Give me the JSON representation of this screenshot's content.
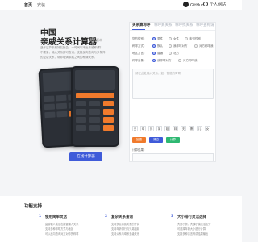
{
  "topbar": {
    "brand": "首页",
    "nav_link": "安装",
    "github": "GitHub",
    "personal": "个人网站"
  },
  "hero": {
    "title_line1": "中国",
    "title_line2": "亲戚关系计算器",
    "version": "最新版本",
    "desc_line1": "逢年过节亲朋好友聚会，一时间叫不出亲戚称谓？",
    "desc_line2": "不要紧，输入关系即可查询，支持反向查询与多条件",
    "desc_line3": "的复杂关系，帮你理清亲戚之间的称谓关系。",
    "cta_label": "在线计算器"
  },
  "panel": {
    "tabs": [
      "关系算称呼",
      "称呼算关系",
      "称呼找关系",
      "称呼查称谓"
    ],
    "rows": [
      {
        "label": "您的性别：",
        "options": [
          "男性",
          "女性",
          "未知性别"
        ],
        "selected": 0
      },
      {
        "label": "称呼方式：",
        "options": [
          "默认",
          "我称呼对方",
          "对方称呼我"
        ],
        "selected": 0
      },
      {
        "label": "地区方言：",
        "options": [
          "普通",
          "北方"
        ],
        "selected": 0
      },
      {
        "label": "称呼对象：",
        "options": [
          "我称呼对方",
          "对方称呼我"
        ],
        "selected": 0
      }
    ],
    "input_placeholder": "请在此处输入关系，如：爸爸的哥哥",
    "keys": [
      "父",
      "母",
      "兄",
      "弟",
      "姐",
      "妹",
      "夫",
      "妻",
      "儿",
      "女"
    ],
    "actions": {
      "back": "回退",
      "clear": "清空",
      "calc": "计算"
    },
    "result_label": "计算结果："
  },
  "features": {
    "title": "功能支持",
    "items": [
      {
        "num": "1",
        "title": "使用简单灵活",
        "lines": [
          "直接输入或点击按键输入关系",
          "支持多种称呼方式与地区",
          "可以反向查询对方对你的称呼"
        ]
      },
      {
        "num": "2",
        "title": "复杂关系查询",
        "lines": [
          "支持多层亲属关系的计算",
          "支持年龄排行与兄弟姐妹",
          "支持父系与母系多级关系"
        ]
      },
      {
        "num": "3",
        "title": "大小排行灵活选择",
        "lines": [
          "大舅小舅、大姨小姨灵活区分",
          "可选择年龄大小进行计算",
          "支持多种方言称谓结果输出"
        ]
      }
    ]
  },
  "colors": {
    "accent": "#3f5bd9",
    "orange": "#f07a2c",
    "green": "#2eb872"
  }
}
